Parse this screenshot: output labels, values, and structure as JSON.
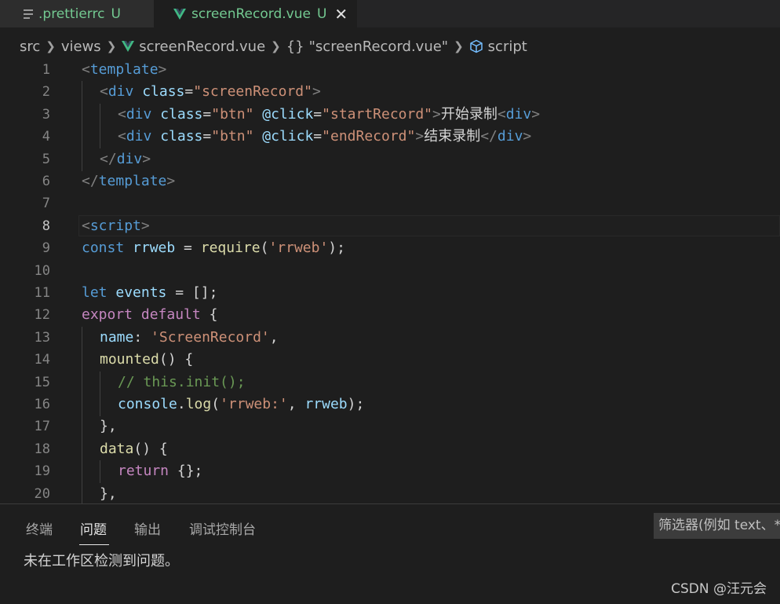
{
  "tabs": [
    {
      "name": ".prettierrc",
      "status": "U",
      "icon": "lines-icon"
    },
    {
      "name": "screenRecord.vue",
      "status": "U",
      "icon": "vue-icon",
      "close": "✕"
    }
  ],
  "breadcrumb": {
    "items": [
      "src",
      "views",
      "screenRecord.vue",
      "\"screenRecord.vue\"",
      "script"
    ],
    "brace": "{}"
  },
  "editor": {
    "current_line": 8,
    "lines": [
      {
        "n": 1,
        "indent": 0,
        "tokens": [
          [
            "punc",
            "<"
          ],
          [
            "tag",
            "template"
          ],
          [
            "punc",
            ">"
          ]
        ]
      },
      {
        "n": 2,
        "indent": 1,
        "tokens": [
          [
            "punc",
            "<"
          ],
          [
            "tag",
            "div"
          ],
          [
            "txt",
            " "
          ],
          [
            "attr",
            "class"
          ],
          [
            "txt",
            "="
          ],
          [
            "str",
            "\"screenRecord\""
          ],
          [
            "punc",
            ">"
          ]
        ]
      },
      {
        "n": 3,
        "indent": 2,
        "tokens": [
          [
            "punc",
            "<"
          ],
          [
            "tag",
            "div"
          ],
          [
            "txt",
            " "
          ],
          [
            "attr",
            "class"
          ],
          [
            "txt",
            "="
          ],
          [
            "str",
            "\"btn\""
          ],
          [
            "txt",
            " "
          ],
          [
            "attr",
            "@click"
          ],
          [
            "txt",
            "="
          ],
          [
            "str",
            "\"startRecord\""
          ],
          [
            "punc",
            ">"
          ],
          [
            "txt",
            "开始录制"
          ],
          [
            "punc",
            "<"
          ],
          [
            "tag",
            "div"
          ],
          [
            "punc",
            ">"
          ]
        ]
      },
      {
        "n": 4,
        "indent": 2,
        "tokens": [
          [
            "punc",
            "<"
          ],
          [
            "tag",
            "div"
          ],
          [
            "txt",
            " "
          ],
          [
            "attr",
            "class"
          ],
          [
            "txt",
            "="
          ],
          [
            "str",
            "\"btn\""
          ],
          [
            "txt",
            " "
          ],
          [
            "attr",
            "@click"
          ],
          [
            "txt",
            "="
          ],
          [
            "str",
            "\"endRecord\""
          ],
          [
            "punc",
            ">"
          ],
          [
            "txt",
            "结束录制"
          ],
          [
            "punc",
            "</"
          ],
          [
            "tag",
            "div"
          ],
          [
            "punc",
            ">"
          ]
        ]
      },
      {
        "n": 5,
        "indent": 1,
        "tokens": [
          [
            "punc",
            "</"
          ],
          [
            "tag",
            "div"
          ],
          [
            "punc",
            ">"
          ]
        ]
      },
      {
        "n": 6,
        "indent": 0,
        "tokens": [
          [
            "punc",
            "</"
          ],
          [
            "tag",
            "template"
          ],
          [
            "punc",
            ">"
          ]
        ]
      },
      {
        "n": 7,
        "indent": 0,
        "tokens": []
      },
      {
        "n": 8,
        "indent": 0,
        "tokens": [
          [
            "punc",
            "<"
          ],
          [
            "tag",
            "script"
          ],
          [
            "punc",
            ">"
          ]
        ]
      },
      {
        "n": 9,
        "indent": 0,
        "tokens": [
          [
            "kw",
            "const"
          ],
          [
            "plain",
            " "
          ],
          [
            "var",
            "rrweb"
          ],
          [
            "plain",
            " = "
          ],
          [
            "fn",
            "require"
          ],
          [
            "plain",
            "("
          ],
          [
            "str",
            "'rrweb'"
          ],
          [
            "plain",
            ");"
          ]
        ]
      },
      {
        "n": 10,
        "indent": 0,
        "tokens": []
      },
      {
        "n": 11,
        "indent": 0,
        "tokens": [
          [
            "kw",
            "let"
          ],
          [
            "plain",
            " "
          ],
          [
            "var",
            "events"
          ],
          [
            "plain",
            " = [];"
          ]
        ]
      },
      {
        "n": 12,
        "indent": 0,
        "tokens": [
          [
            "ctl",
            "export"
          ],
          [
            "plain",
            " "
          ],
          [
            "ctl",
            "default"
          ],
          [
            "plain",
            " {"
          ]
        ]
      },
      {
        "n": 13,
        "indent": 1,
        "tokens": [
          [
            "var",
            "name"
          ],
          [
            "plain",
            ": "
          ],
          [
            "str",
            "'ScreenRecord'"
          ],
          [
            "plain",
            ","
          ]
        ]
      },
      {
        "n": 14,
        "indent": 1,
        "tokens": [
          [
            "fn",
            "mounted"
          ],
          [
            "plain",
            "() {"
          ]
        ]
      },
      {
        "n": 15,
        "indent": 2,
        "tokens": [
          [
            "cmt",
            "// this.init();"
          ]
        ]
      },
      {
        "n": 16,
        "indent": 2,
        "tokens": [
          [
            "var",
            "console"
          ],
          [
            "plain",
            "."
          ],
          [
            "fn",
            "log"
          ],
          [
            "plain",
            "("
          ],
          [
            "str",
            "'rrweb:'"
          ],
          [
            "plain",
            ", "
          ],
          [
            "var",
            "rrweb"
          ],
          [
            "plain",
            ");"
          ]
        ]
      },
      {
        "n": 17,
        "indent": 1,
        "tokens": [
          [
            "plain",
            "},"
          ]
        ]
      },
      {
        "n": 18,
        "indent": 1,
        "tokens": [
          [
            "fn",
            "data"
          ],
          [
            "plain",
            "() {"
          ]
        ]
      },
      {
        "n": 19,
        "indent": 2,
        "tokens": [
          [
            "ctl",
            "return"
          ],
          [
            "plain",
            " {};"
          ]
        ]
      },
      {
        "n": 20,
        "indent": 1,
        "tokens": [
          [
            "plain",
            "},"
          ]
        ]
      }
    ]
  },
  "panel": {
    "tabs": [
      "终端",
      "问题",
      "输出",
      "调试控制台"
    ],
    "active_tab": "问题",
    "filter_placeholder": "筛选器(例如 text、**/",
    "message": "未在工作区检测到问题。"
  },
  "watermark": "CSDN @汪元会",
  "colors": {
    "accent_untracked": "#73c991",
    "vue_green": "#41b883",
    "editor_bg": "#1e1e1e"
  }
}
